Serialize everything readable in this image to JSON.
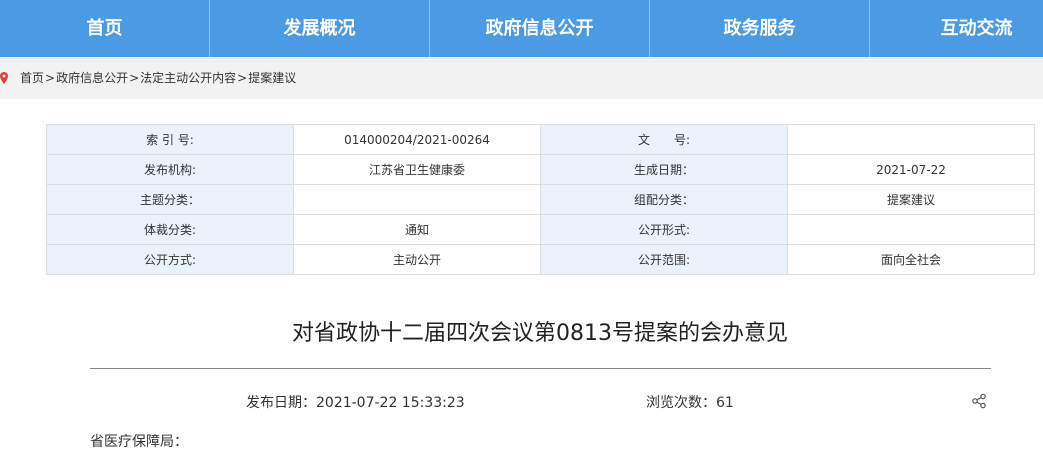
{
  "nav": {
    "items": [
      "首页",
      "发展概况",
      "政府信息公开",
      "政务服务",
      "互动交流"
    ]
  },
  "breadcrumb": {
    "items": [
      "首页",
      "政府信息公开",
      "法定主动公开内容",
      "提案建议"
    ],
    "separator": ">"
  },
  "meta": {
    "rows": [
      [
        "索 引 号:",
        "014000204/2021-00264",
        "文　　号:",
        ""
      ],
      [
        "发布机构:",
        "江苏省卫生健康委",
        "生成日期：",
        "2021-07-22"
      ],
      [
        "主题分类：",
        "",
        "组配分类：",
        "提案建议"
      ],
      [
        "体裁分类:",
        "通知",
        "公开形式:",
        ""
      ],
      [
        "公开方式:",
        "主动公开",
        "公开范围:",
        "面向全社会"
      ]
    ]
  },
  "article": {
    "title": "对省政协十二届四次会议第0813号提案的会办意见",
    "publish_label": "发布日期：2021-07-22 15:33:23",
    "views_label": "浏览次数：61",
    "first_line": "省医疗保障局："
  },
  "colors": {
    "nav_bg": "#4a9be3",
    "crumb_bg": "#f2f2f2",
    "table_label_bg": "#eaf2fb",
    "pin_red": "#e03c31"
  },
  "icons": {
    "breadcrumb": "location-pin-icon",
    "share": "share-icon"
  }
}
